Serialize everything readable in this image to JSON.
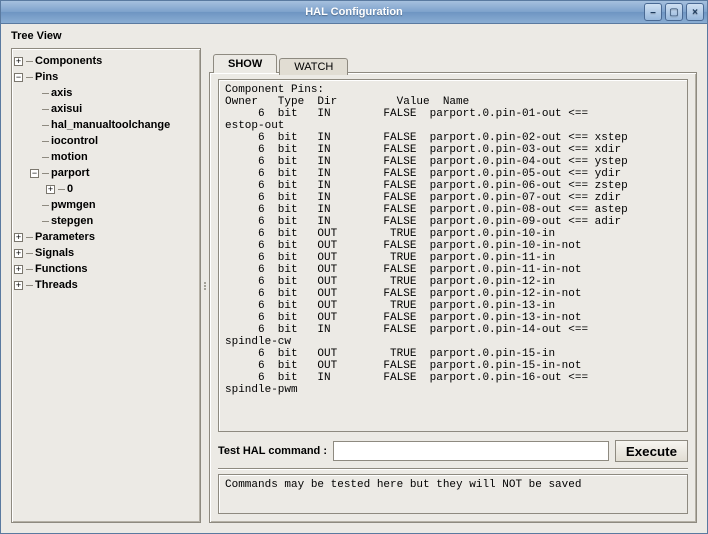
{
  "window": {
    "title": "HAL Configuration"
  },
  "sidebar_label": "Tree View",
  "tree": [
    {
      "depth": 0,
      "toggle": "+",
      "label": "Components",
      "bold": true
    },
    {
      "depth": 0,
      "toggle": "-",
      "label": "Pins",
      "bold": true
    },
    {
      "depth": 1,
      "toggle": " ",
      "label": "axis",
      "bold": true
    },
    {
      "depth": 1,
      "toggle": " ",
      "label": "axisui",
      "bold": true
    },
    {
      "depth": 1,
      "toggle": " ",
      "label": "hal_manualtoolchange",
      "bold": true
    },
    {
      "depth": 1,
      "toggle": " ",
      "label": "iocontrol",
      "bold": true
    },
    {
      "depth": 1,
      "toggle": " ",
      "label": "motion",
      "bold": true
    },
    {
      "depth": 1,
      "toggle": "-",
      "label": "parport",
      "bold": true
    },
    {
      "depth": 2,
      "toggle": "+",
      "label": "0",
      "bold": true
    },
    {
      "depth": 1,
      "toggle": " ",
      "label": "pwmgen",
      "bold": true
    },
    {
      "depth": 1,
      "toggle": " ",
      "label": "stepgen",
      "bold": true
    },
    {
      "depth": 0,
      "toggle": "+",
      "label": "Parameters",
      "bold": true
    },
    {
      "depth": 0,
      "toggle": "+",
      "label": "Signals",
      "bold": true
    },
    {
      "depth": 0,
      "toggle": "+",
      "label": "Functions",
      "bold": true
    },
    {
      "depth": 0,
      "toggle": "+",
      "label": "Threads",
      "bold": true
    }
  ],
  "tabs": {
    "show": "SHOW",
    "watch": "WATCH",
    "active": "show"
  },
  "listing_header": "Component Pins:",
  "listing_columns": "Owner   Type  Dir         Value  Name",
  "rows": [
    {
      "owner": "6",
      "type": "bit",
      "dir": "IN",
      "value": "FALSE",
      "name": "parport.0.pin-01-out <== "
    },
    {
      "raw": "estop-out"
    },
    {
      "owner": "6",
      "type": "bit",
      "dir": "IN",
      "value": "FALSE",
      "name": "parport.0.pin-02-out <== xstep"
    },
    {
      "owner": "6",
      "type": "bit",
      "dir": "IN",
      "value": "FALSE",
      "name": "parport.0.pin-03-out <== xdir"
    },
    {
      "owner": "6",
      "type": "bit",
      "dir": "IN",
      "value": "FALSE",
      "name": "parport.0.pin-04-out <== ystep"
    },
    {
      "owner": "6",
      "type": "bit",
      "dir": "IN",
      "value": "FALSE",
      "name": "parport.0.pin-05-out <== ydir"
    },
    {
      "owner": "6",
      "type": "bit",
      "dir": "IN",
      "value": "FALSE",
      "name": "parport.0.pin-06-out <== zstep"
    },
    {
      "owner": "6",
      "type": "bit",
      "dir": "IN",
      "value": "FALSE",
      "name": "parport.0.pin-07-out <== zdir"
    },
    {
      "owner": "6",
      "type": "bit",
      "dir": "IN",
      "value": "FALSE",
      "name": "parport.0.pin-08-out <== astep"
    },
    {
      "owner": "6",
      "type": "bit",
      "dir": "IN",
      "value": "FALSE",
      "name": "parport.0.pin-09-out <== adir"
    },
    {
      "owner": "6",
      "type": "bit",
      "dir": "OUT",
      "value": "TRUE",
      "name": "parport.0.pin-10-in"
    },
    {
      "owner": "6",
      "type": "bit",
      "dir": "OUT",
      "value": "FALSE",
      "name": "parport.0.pin-10-in-not"
    },
    {
      "owner": "6",
      "type": "bit",
      "dir": "OUT",
      "value": "TRUE",
      "name": "parport.0.pin-11-in"
    },
    {
      "owner": "6",
      "type": "bit",
      "dir": "OUT",
      "value": "FALSE",
      "name": "parport.0.pin-11-in-not"
    },
    {
      "owner": "6",
      "type": "bit",
      "dir": "OUT",
      "value": "TRUE",
      "name": "parport.0.pin-12-in"
    },
    {
      "owner": "6",
      "type": "bit",
      "dir": "OUT",
      "value": "FALSE",
      "name": "parport.0.pin-12-in-not"
    },
    {
      "owner": "6",
      "type": "bit",
      "dir": "OUT",
      "value": "TRUE",
      "name": "parport.0.pin-13-in"
    },
    {
      "owner": "6",
      "type": "bit",
      "dir": "OUT",
      "value": "FALSE",
      "name": "parport.0.pin-13-in-not"
    },
    {
      "owner": "6",
      "type": "bit",
      "dir": "IN",
      "value": "FALSE",
      "name": "parport.0.pin-14-out <== "
    },
    {
      "raw": "spindle-cw"
    },
    {
      "owner": "6",
      "type": "bit",
      "dir": "OUT",
      "value": "TRUE",
      "name": "parport.0.pin-15-in"
    },
    {
      "owner": "6",
      "type": "bit",
      "dir": "OUT",
      "value": "FALSE",
      "name": "parport.0.pin-15-in-not"
    },
    {
      "owner": "6",
      "type": "bit",
      "dir": "IN",
      "value": "FALSE",
      "name": "parport.0.pin-16-out <== "
    },
    {
      "raw": "spindle-pwm"
    }
  ],
  "cmd": {
    "label": "Test HAL command :",
    "value": "",
    "placeholder": "",
    "button": "Execute"
  },
  "hint": "Commands may be tested here but they will NOT be saved"
}
